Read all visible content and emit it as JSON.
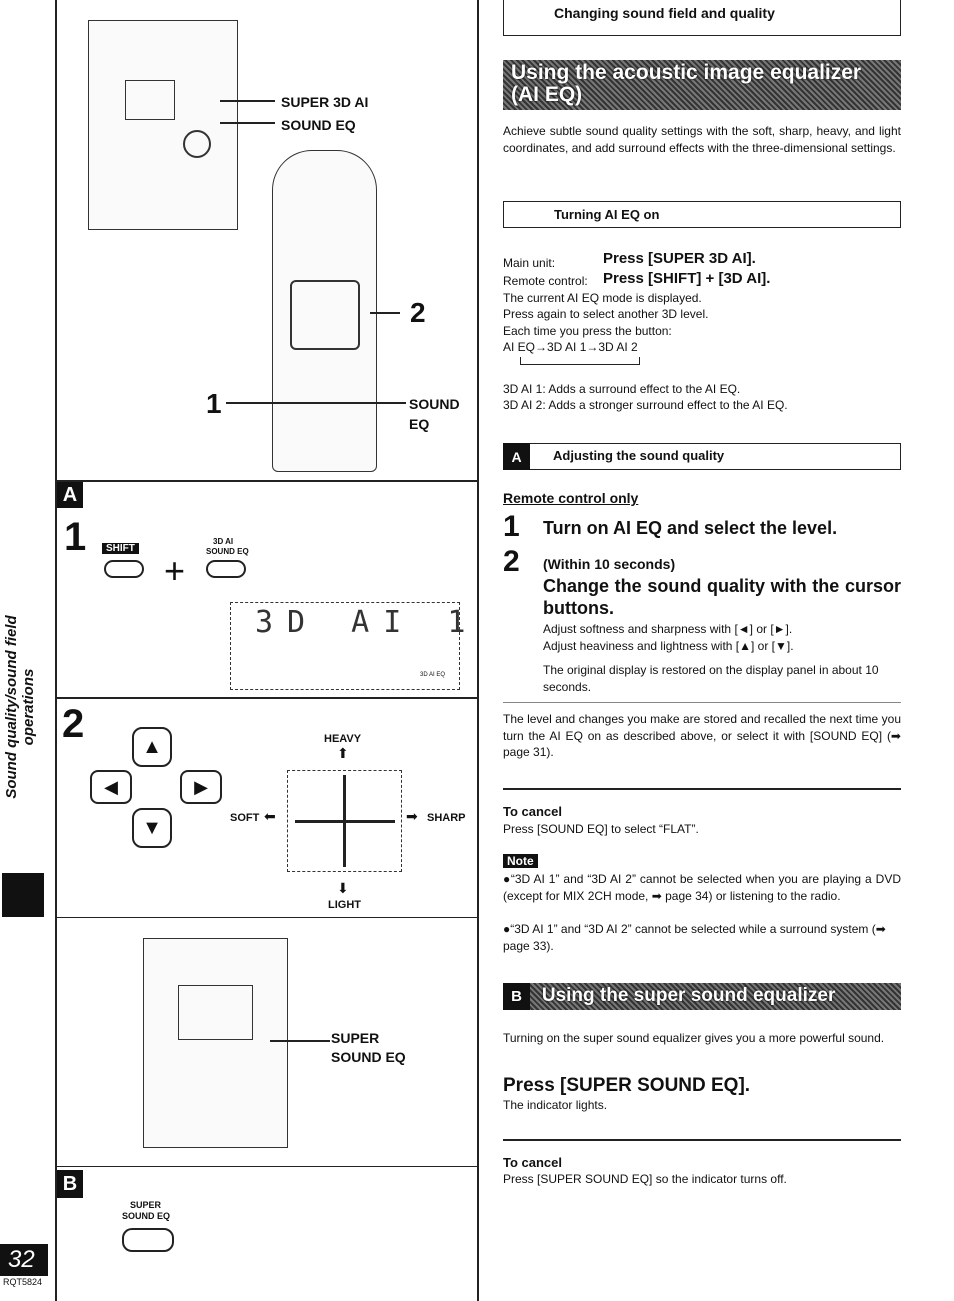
{
  "sidebar": {
    "section_title": "Sound quality/sound field operations",
    "page_number": "32",
    "doc_code": "RQT5824"
  },
  "left": {
    "fig_top": {
      "label_super3dai": "SUPER 3D AI",
      "label_soundeq": "SOUND EQ",
      "step1": "1",
      "step2": "2",
      "label_sound": "SOUND",
      "label_eq": "EQ"
    },
    "section_a": {
      "letter": "A",
      "step1": "1",
      "shift_label": "SHIFT",
      "plus": "+",
      "btn_label": "3D AI\nSOUND EQ",
      "btn_label_1": "3D AI",
      "btn_label_2": "SOUND EQ",
      "display_text": "3D AI 1",
      "display_small": "3D AI EQ",
      "step2": "2",
      "heavy": "HEAVY",
      "light": "LIGHT",
      "soft": "SOFT",
      "sharp": "SHARP"
    },
    "fig_mid": {
      "label_super": "SUPER",
      "label_soundeq": "SOUND EQ"
    },
    "section_b": {
      "letter": "B",
      "btn_label_1": "SUPER",
      "btn_label_2": "SOUND EQ"
    }
  },
  "right": {
    "header": "Changing sound field and quality",
    "banner1": "Using the acoustic image equalizer (AI EQ)",
    "intro": "Achieve subtle sound quality settings with the soft, sharp, heavy, and light coordinates, and add surround effects with the three-dimensional settings.",
    "turning_title": "Turning AI EQ on",
    "main_unit_label": "Main unit:",
    "main_unit_action": "Press [SUPER 3D AI].",
    "remote_label": "Remote control:",
    "remote_action": "Press [SHIFT] + [3D AI].",
    "lines": [
      "The current AI EQ mode is displayed.",
      "Press again to select another 3D level.",
      "Each time you press the button:",
      "AI EQ→3D AI 1→3D AI 2"
    ],
    "modes": [
      "3D AI 1: Adds a surround effect to the AI EQ.",
      "3D AI 2: Adds a stronger surround effect to the AI EQ."
    ],
    "adjust_letter": "A",
    "adjust_title": "Adjusting the sound quality",
    "remote_only": "Remote control only",
    "step1_num": "1",
    "step1": "Turn on AI EQ and select the level.",
    "step2_num": "2",
    "step2_sub": "(Within 10 seconds)",
    "step2": "Change the sound quality with the cursor buttons.",
    "adjust_lines": [
      "Adjust softness and sharpness with [◄] or [►].",
      "Adjust heaviness and lightness with [▲] or [▼]."
    ],
    "restore": "The original display is restored on the display panel in about 10 seconds.",
    "stored": "The level and changes you make are stored and recalled the next time you turn the AI EQ on as described above, or select it with [SOUND EQ] (➡ page 31).",
    "cancel1_title": "To cancel",
    "cancel1": "Press [SOUND EQ] to select “FLAT”.",
    "note_label": "Note",
    "notes": [
      "●“3D AI 1” and “3D AI 2” cannot be selected when you are playing a DVD (except for MIX 2CH mode, ➡ page 34) or listening to the radio.",
      "●“3D AI 1” and “3D AI 2” cannot be selected while a surround system (➡ page 33)."
    ],
    "banner2_letter": "B",
    "banner2": "Using the super sound equalizer",
    "super_intro": "Turning on the super sound equalizer gives you a more powerful sound.",
    "super_action": "Press [SUPER SOUND EQ].",
    "super_indicator": "The indicator lights.",
    "cancel2_title": "To cancel",
    "cancel2": "Press [SUPER SOUND EQ] so the indicator turns off."
  }
}
